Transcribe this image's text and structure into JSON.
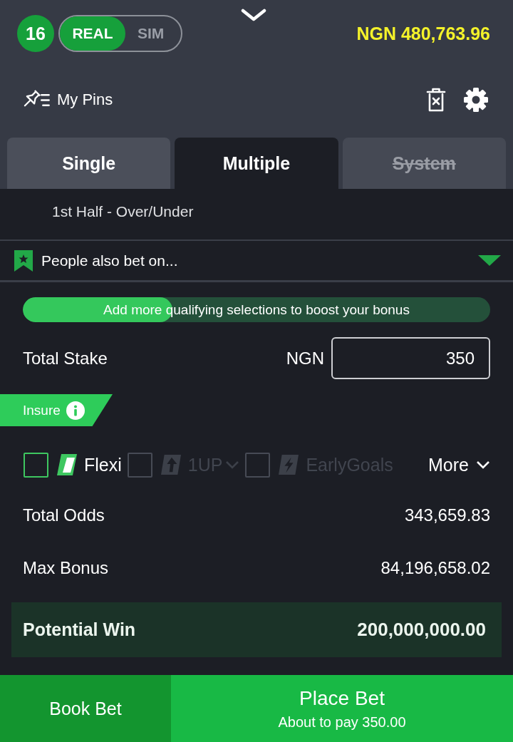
{
  "header": {
    "level_badge": "16",
    "modes": [
      {
        "label": "REAL",
        "selected": true
      },
      {
        "label": "SIM",
        "selected": false
      }
    ],
    "balance": "NGN 480,763.96"
  },
  "toolbar": {
    "pins_label": "My Pins"
  },
  "bet_tabs": [
    {
      "label": "Single",
      "selected": false,
      "disabled": false
    },
    {
      "label": "Multiple",
      "selected": true,
      "disabled": false
    },
    {
      "label": "System",
      "selected": false,
      "disabled": true
    }
  ],
  "selection": {
    "market": "1st Half - Over/Under"
  },
  "people_also_bet": {
    "label": "People also bet on...",
    "expanded": false
  },
  "bonus_progress": {
    "message": "Add more qualifying selections to boost your bonus",
    "level": 0.32
  },
  "stake": {
    "label": "Total Stake",
    "currency": "NGN",
    "value": "350"
  },
  "insure": {
    "label": "Insure"
  },
  "options": [
    {
      "kind": "flexi",
      "label": "Flexi",
      "checked": false,
      "disabled": false
    },
    {
      "kind": "oneup",
      "label": "1UP",
      "checked": false,
      "disabled": true
    },
    {
      "kind": "earlygoals",
      "label": "EarlyGoals",
      "checked": false,
      "disabled": true
    }
  ],
  "more": {
    "label": "More"
  },
  "summary": [
    {
      "label": "Total Odds",
      "value": "343,659.83"
    },
    {
      "label": "Max Bonus",
      "value": "84,196,658.02"
    }
  ],
  "potential_win": {
    "label": "Potential Win",
    "value": "200,000,000.00"
  },
  "actions": {
    "book": "Book Bet",
    "place": "Place Bet",
    "pay_note": "About to pay 350.00"
  }
}
